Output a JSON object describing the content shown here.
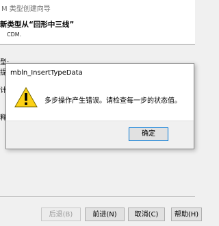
{
  "window": {
    "title": "M 类型创建向导"
  },
  "header": {
    "title": "新类型从“回形中三线”",
    "subtitle": "CDM."
  },
  "form": {
    "type_label": "型:",
    "frag1": "提",
    "frag2": "计",
    "frag3": "释"
  },
  "buttons": {
    "back": "后退(B)",
    "next": "前进(N)",
    "cancel": "取消(C)",
    "help": "帮助(H)"
  },
  "dialog": {
    "title": "mbln_InsertTypeData",
    "message": "多步操作产生错误。请检查每一步的状态值。",
    "ok": "确定",
    "icon": "warning-icon"
  }
}
